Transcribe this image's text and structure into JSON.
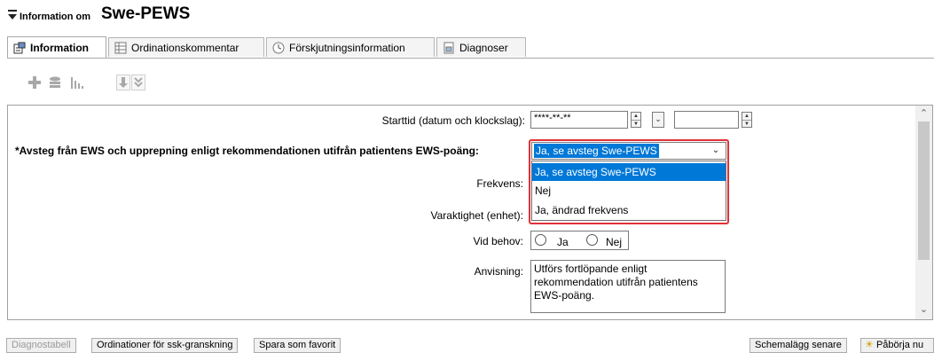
{
  "header": {
    "small_title": "Information om",
    "big_title": "Swe-PEWS"
  },
  "tabs": [
    {
      "label": "Information",
      "icon": "info-sheet-icon",
      "active": true
    },
    {
      "label": "Ordinationskommentar",
      "icon": "comment-grid-icon",
      "active": false
    },
    {
      "label": "Förskjutningsinformation",
      "icon": "clock-icon",
      "active": false
    },
    {
      "label": "Diagnoser",
      "icon": "diagnosis-doc-icon",
      "active": false
    }
  ],
  "toolbar": {
    "icons": [
      "add-icon",
      "stack-icon",
      "chart-icon",
      "move-down-icon",
      "collapse-icon"
    ]
  },
  "form": {
    "start_label": "Starttid (datum och klockslag):",
    "start_date_value": "****-**-**",
    "start_time_value": "",
    "deviation_label": "*Avsteg från EWS och upprepning enligt rekommendationen utifrån patientens EWS-poäng:",
    "deviation_selected": "Ja, se avsteg Swe-PEWS",
    "deviation_options": [
      "Ja, se avsteg Swe-PEWS",
      "Nej",
      "Ja, ändrad frekvens"
    ],
    "frequency_label": "Frekvens:",
    "duration_label": "Varaktighet (enhet):",
    "as_needed_label": "Vid behov:",
    "as_needed_yes": "Ja",
    "as_needed_no": "Nej",
    "instruction_label": "Anvisning:",
    "instruction_text": "Utförs fortlöpande enligt rekommendation utifrån patientens EWS-poäng."
  },
  "footer": {
    "buttons": [
      {
        "label": "Diagnostabell",
        "enabled": false
      },
      {
        "label": "Ordinationer för ssk-granskning",
        "enabled": true
      },
      {
        "label": "Spara som favorit",
        "enabled": true
      }
    ],
    "schedule_later": "Schemalägg senare",
    "start_now": "Påbörja nu"
  },
  "colors": {
    "highlight_border": "#e0323a",
    "selection_blue": "#0078d7"
  }
}
